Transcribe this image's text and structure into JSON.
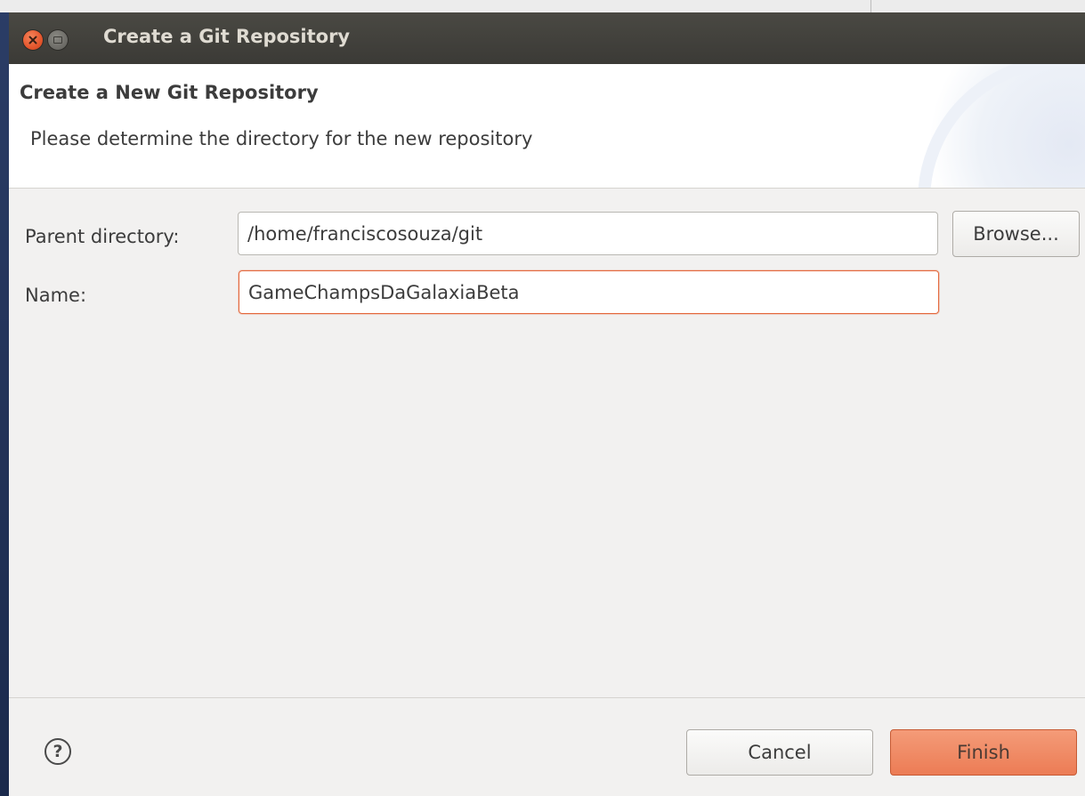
{
  "window": {
    "title": "Create a Git Repository"
  },
  "header": {
    "title": "Create a New Git Repository",
    "description": "Please determine the directory for the new repository"
  },
  "form": {
    "parent_directory_label": "Parent directory:",
    "parent_directory_value": "/home/franciscosouza/git",
    "browse_label": "Browse...",
    "name_label": "Name:",
    "name_value": "GameChampsDaGalaxiaBeta"
  },
  "footer": {
    "help_glyph": "?",
    "cancel_label": "Cancel",
    "finish_label": "Finish"
  },
  "colors": {
    "titlebar": "#3b3a36",
    "accent": "#ec7c55",
    "focus_border": "#e4683c",
    "close_button": "#e5562d"
  },
  "icons": [
    "close-icon",
    "minimize-icon",
    "help-icon"
  ]
}
